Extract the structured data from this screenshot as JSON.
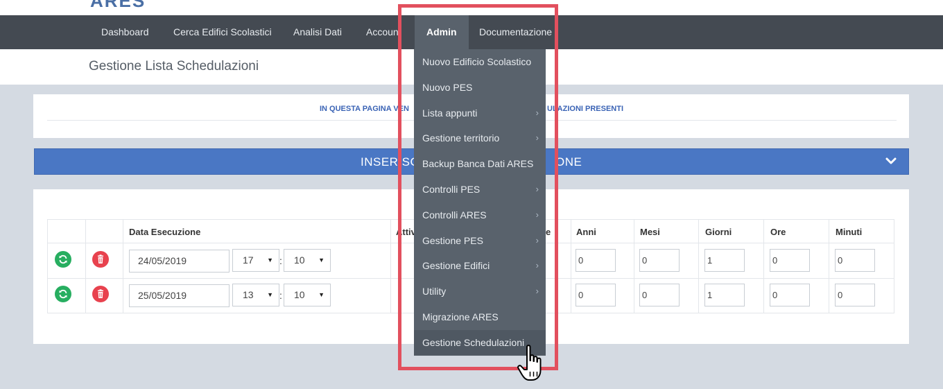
{
  "logo": {
    "fragment": "ARES"
  },
  "nav": {
    "items": [
      "Dashboard",
      "Cerca Edifici Scolastici",
      "Analisi Dati",
      "Accoun",
      "Admin",
      "Documentazione"
    ]
  },
  "page": {
    "title": "Gestione Lista Schedulazioni"
  },
  "info": {
    "left": "IN QUESTA PAGINA VEN",
    "right": "ULAZIONI PRESENTI"
  },
  "insert": {
    "left": "INSERISC",
    "right": "ONE",
    "icon": "chevron-down-icon"
  },
  "table": {
    "headers": {
      "data": "Data Esecuzione",
      "attivo": "Attiv",
      "frag": "e",
      "anni": "Anni",
      "mesi": "Mesi",
      "giorni": "Giorni",
      "ore": "Ore",
      "minuti": "Minuti"
    },
    "colon": ":",
    "rows": [
      {
        "date": "24/05/2019",
        "hour": "17",
        "minute": "10",
        "anni": "0",
        "mesi": "0",
        "giorni": "1",
        "ore": "0",
        "minuti": "0"
      },
      {
        "date": "25/05/2019",
        "hour": "13",
        "minute": "10",
        "anni": "0",
        "mesi": "0",
        "giorni": "1",
        "ore": "0",
        "minuti": "0"
      }
    ]
  },
  "dropdown": {
    "items": [
      {
        "label": "Nuovo Edificio Scolastico",
        "arrow": ""
      },
      {
        "label": "Nuovo PES",
        "arrow": ""
      },
      {
        "label": "Lista appunti",
        "arrow": "›"
      },
      {
        "label": "Gestione territorio",
        "arrow": "›"
      },
      {
        "label": "Backup Banca Dati ARES",
        "arrow": ""
      },
      {
        "label": "Controlli PES",
        "arrow": "›"
      },
      {
        "label": "Controlli ARES",
        "arrow": "›"
      },
      {
        "label": "Gestione PES",
        "arrow": "›"
      },
      {
        "label": "Gestione Edifici",
        "arrow": "›"
      },
      {
        "label": "Utility",
        "arrow": "›"
      },
      {
        "label": "Migrazione ARES",
        "arrow": ""
      },
      {
        "label": "Gestione Schedulazioni",
        "arrow": ""
      }
    ]
  },
  "colors": {
    "navbar": "#444a52",
    "dropdown": "#59626c",
    "accent_blue": "#4a77c4",
    "highlight": "#e2505e",
    "green": "#27ae60",
    "red": "#e8424e"
  }
}
